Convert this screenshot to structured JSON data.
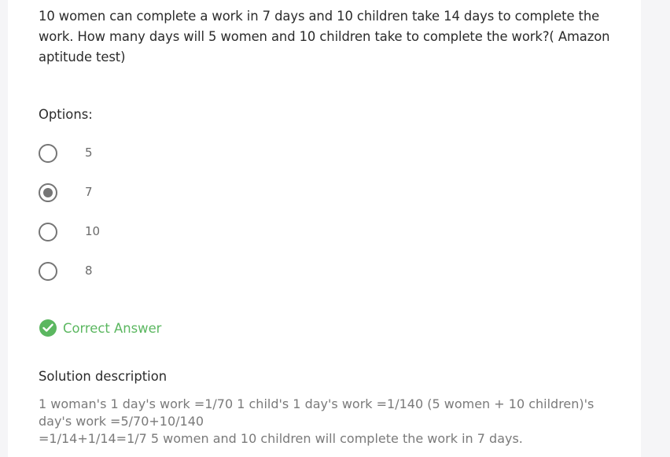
{
  "question": {
    "text": "10 women can complete a work in 7 days and 10 children take 14 days to complete the work. How many days will 5 women and 10 children take to complete the work?( Amazon aptitude test)"
  },
  "options": {
    "label": "Options:",
    "items": [
      {
        "label": "5",
        "selected": false
      },
      {
        "label": "7",
        "selected": true
      },
      {
        "label": "10",
        "selected": false
      },
      {
        "label": "8",
        "selected": false
      }
    ]
  },
  "result": {
    "label": "Correct Answer",
    "icon": "check-circle-icon",
    "color": "#5bb760"
  },
  "solution": {
    "title": "Solution description",
    "line1": "1 woman's 1 day's work =1/70 1 child's 1 day's work =1/140 (5 women + 10 children)'s day's work =5/70+10/140",
    "line2": "=1/14+1/14=1/7 5 women and 10 children will complete the work in 7 days."
  }
}
